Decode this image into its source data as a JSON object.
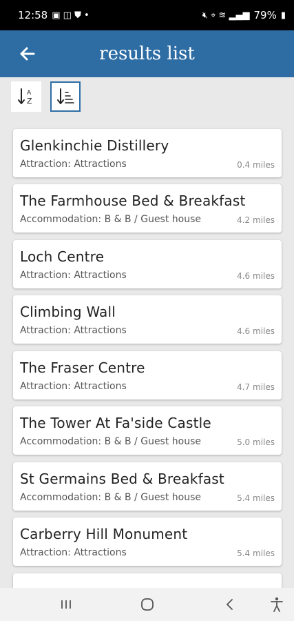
{
  "status": {
    "time": "12:58",
    "battery": "79%"
  },
  "header": {
    "title": "results list"
  },
  "results": [
    {
      "title": "Glenkinchie Distillery",
      "subtitle": "Attraction: Attractions",
      "distance": "0.4 miles"
    },
    {
      "title": "The Farmhouse Bed & Breakfast",
      "subtitle": "Accommodation: B & B / Guest house",
      "distance": "4.2 miles"
    },
    {
      "title": "Loch Centre",
      "subtitle": "Attraction: Attractions",
      "distance": "4.6 miles"
    },
    {
      "title": "Climbing Wall",
      "subtitle": "Attraction: Attractions",
      "distance": "4.6 miles"
    },
    {
      "title": "The Fraser Centre",
      "subtitle": "Attraction: Attractions",
      "distance": "4.7 miles"
    },
    {
      "title": "The Tower At Fa'side Castle",
      "subtitle": "Accommodation: B & B / Guest house",
      "distance": "5.0 miles"
    },
    {
      "title": "St Germains Bed & Breakfast",
      "subtitle": "Accommodation: B & B / Guest house",
      "distance": "5.4 miles"
    },
    {
      "title": "Carberry Hill Monument",
      "subtitle": "Attraction: Attractions",
      "distance": "5.4 miles"
    }
  ],
  "icons": {
    "back": "arrow-left-icon",
    "sort_alpha": "sort-alphabetical-icon",
    "sort_distance": "sort-distance-icon"
  },
  "colors": {
    "app_bar": "#2e6da4",
    "selected_border": "#2e6da4"
  }
}
